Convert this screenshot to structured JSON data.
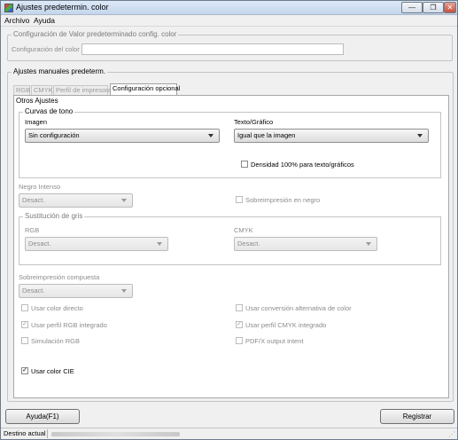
{
  "window": {
    "title": "Ajustes predetermin. color",
    "minimize": "—",
    "restore": "❐",
    "close": "✕"
  },
  "menu": [
    {
      "label": "Archivo"
    },
    {
      "label": "Ayuda"
    }
  ],
  "valor_group": {
    "legend": "Configuración de Valor predeterminado config. color",
    "field_label": "Configuración del color",
    "field_value": ""
  },
  "manual_group": {
    "legend": "Ajustes manuales predeterm.",
    "tabs": [
      {
        "label": "RGB",
        "active": false
      },
      {
        "label": "CMYK",
        "active": false
      },
      {
        "label": "Perfil de impresora",
        "active": false
      },
      {
        "label": "Configuración opcional",
        "active": true
      }
    ]
  },
  "otros": {
    "legend": "Otros Ajustes",
    "curvas": {
      "legend": "Curvas de tono",
      "imagen_label": "Imagen",
      "imagen_value": "Sin configuración",
      "texto_label": "Texto/Gráfico",
      "texto_value": "Igual que la imagen",
      "densidad_label": "Densidad 100% para texto/gráficos",
      "densidad_checked": false
    },
    "negro": {
      "label": "Negro Intenso",
      "value": "Desact.",
      "sobre_label": "Sobreimpresión en negro"
    },
    "gris": {
      "legend": "Sustitución de gris",
      "rgb_label": "RGB",
      "rgb_value": "Desact.",
      "cmyk_label": "CMYK",
      "cmyk_value": "Desact."
    },
    "compuesta": {
      "label": "Sobreimpresión compuesta",
      "value": "Desact."
    },
    "checks": {
      "color_directo": "Usar color directo",
      "conv_alternativa": "Usar conversión alternativa de color",
      "perfil_rgb": "Usar perfil RGB integrado",
      "perfil_cmyk": "Usar perfil CMYK integrado",
      "simulacion_rgb": "Simulación RGB",
      "pdfx": "PDF/X output intent",
      "color_cie": "Usar color CIE",
      "check_mark": "✓"
    }
  },
  "buttons": {
    "ayuda": "Ayuda(F1)",
    "registrar": "Registrar"
  },
  "status": {
    "label": "Destino actual"
  }
}
